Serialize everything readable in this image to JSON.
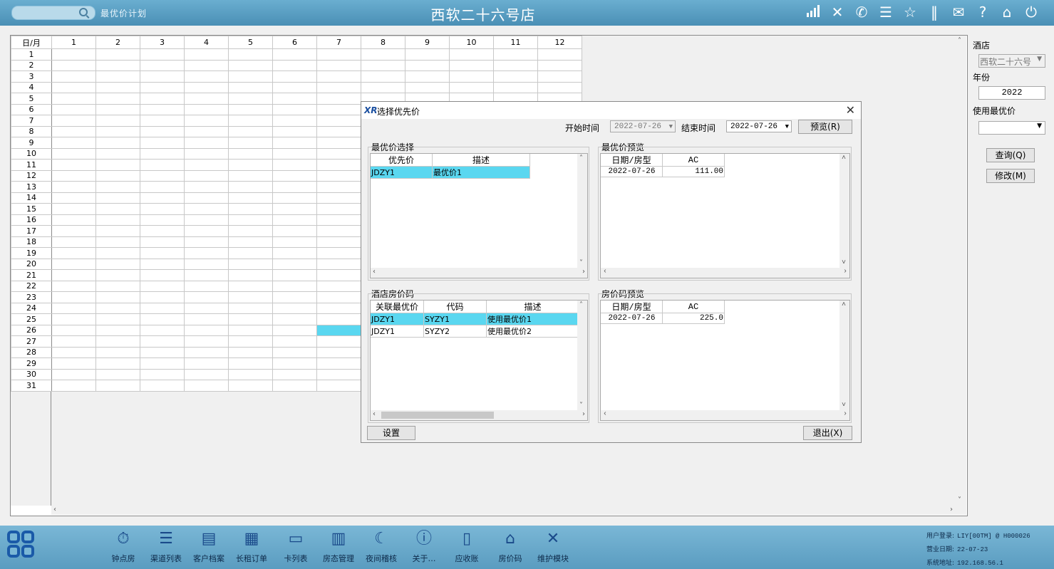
{
  "header": {
    "module_label": "最优价计划",
    "title": "西软二十六号店",
    "icons": [
      "signal-icon",
      "tools-icon",
      "phone-icon",
      "menu-icon",
      "star-icon",
      "columns-icon",
      "mail-icon",
      "help-icon",
      "home-icon",
      "power-icon"
    ]
  },
  "grid": {
    "corner": "日/月",
    "months": [
      "1",
      "2",
      "3",
      "4",
      "5",
      "6",
      "7",
      "8",
      "9",
      "10",
      "11",
      "12"
    ],
    "days": [
      "1",
      "2",
      "3",
      "4",
      "5",
      "6",
      "7",
      "8",
      "9",
      "10",
      "11",
      "12",
      "13",
      "14",
      "15",
      "16",
      "17",
      "18",
      "19",
      "20",
      "21",
      "22",
      "23",
      "24",
      "25",
      "26",
      "27",
      "28",
      "29",
      "30",
      "31"
    ],
    "highlight_day": 26,
    "highlight_month": 7
  },
  "right_panel": {
    "hotel_label": "酒店",
    "hotel_value": "西软二十六号",
    "year_label": "年份",
    "year_value": "2022",
    "best_price_label": "使用最优价",
    "best_price_value": "",
    "query_button": "查询(Q)",
    "modify_button": "修改(M)"
  },
  "dialog": {
    "logo": "XR",
    "title": "选择优先价",
    "start_label": "开始时间",
    "start_value": "2022-07-26",
    "end_label": "结束时间",
    "end_value": "2022-07-26",
    "preview_button": "预览(R)",
    "best_select": {
      "title": "最优价选择",
      "headers": [
        "优先价",
        "描述"
      ],
      "rows": [
        [
          "JDZY1",
          "最优价1"
        ]
      ]
    },
    "best_preview": {
      "title": "最优价预览",
      "headers": [
        "日期/房型",
        "AC"
      ],
      "rows": [
        [
          "2022-07-26",
          "111.00"
        ]
      ]
    },
    "hotel_codes": {
      "title": "酒店房价码",
      "headers": [
        "关联最优价",
        "代码",
        "描述"
      ],
      "rows": [
        [
          "JDZY1",
          "SYZY1",
          "使用最优价1"
        ],
        [
          "JDZY1",
          "SYZY2",
          "使用最优价2"
        ]
      ]
    },
    "code_preview": {
      "title": "房价码预览",
      "headers": [
        "日期/房型",
        "AC"
      ],
      "rows": [
        [
          "2022-07-26",
          "225.0"
        ]
      ]
    },
    "set_button": "设置",
    "exit_button": "退出(X)"
  },
  "taskbar": {
    "items": [
      {
        "label": "钟点房",
        "icon": "stopwatch-icon"
      },
      {
        "label": "渠道列表",
        "icon": "list-icon"
      },
      {
        "label": "客户档案",
        "icon": "profile-icon"
      },
      {
        "label": "长租订单",
        "icon": "building-icon"
      },
      {
        "label": "卡列表",
        "icon": "card-icon"
      },
      {
        "label": "房态管理",
        "icon": "grid-icon"
      },
      {
        "label": "夜间稽核",
        "icon": "moon-icon"
      },
      {
        "label": "关于…",
        "icon": "info-icon"
      },
      {
        "label": "应收账",
        "icon": "clipboard-icon"
      },
      {
        "label": "房价码",
        "icon": "house-icon"
      },
      {
        "label": "维护模块",
        "icon": "wrench-icon"
      }
    ],
    "status": {
      "user_label": "用户登录:",
      "user_value": "LIY[00TM] @ H000026",
      "biz_label": "营业日期:",
      "biz_value": "22-07-23",
      "sys_label": "系统地址:",
      "sys_value": "192.168.56.1"
    }
  }
}
